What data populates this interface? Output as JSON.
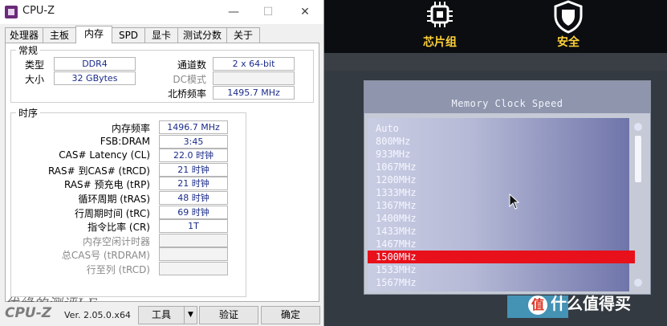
{
  "cpuz": {
    "app_title": "CPU-Z",
    "window_buttons": {
      "minimize": "—",
      "maximize": "☐",
      "close": "✕"
    },
    "tabs": [
      {
        "label": "处理器"
      },
      {
        "label": "主板"
      },
      {
        "label": "内存"
      },
      {
        "label": "SPD"
      },
      {
        "label": "显卡"
      },
      {
        "label": "测试分数"
      },
      {
        "label": "关于"
      }
    ],
    "general": {
      "legend": "常规",
      "type_label": "类型",
      "type_value": "DDR4",
      "size_label": "大小",
      "size_value": "32 GBytes",
      "channels_label": "通道数",
      "channels_value": "2 x 64-bit",
      "dc_mode_label": "DC模式",
      "dc_mode_value": "",
      "nb_freq_label": "北桥频率",
      "nb_freq_value": "1495.7 MHz"
    },
    "timings": {
      "legend": "时序",
      "rows": [
        {
          "label": "内存频率",
          "value": "1496.7 MHz"
        },
        {
          "label": "FSB:DRAM",
          "value": "3:45"
        },
        {
          "label": "CAS# Latency (CL)",
          "value": "22.0 时钟"
        },
        {
          "label": "RAS# 到CAS# (tRCD)",
          "value": "21 时钟"
        },
        {
          "label": "RAS# 预充电 (tRP)",
          "value": "21 时钟"
        },
        {
          "label": "循环周期 (tRAS)",
          "value": "48 时钟"
        },
        {
          "label": "行周期时间 (tRC)",
          "value": "69 时钟"
        },
        {
          "label": "指令比率 (CR)",
          "value": "1T"
        },
        {
          "label": "内存空闲计时器",
          "value": ""
        },
        {
          "label": "总CAS号 (tRDRAM)",
          "value": ""
        },
        {
          "label": "行至列 (tRCD)",
          "value": ""
        }
      ]
    },
    "footer": {
      "brand": "CPU-Z",
      "version": "Ver. 2.05.0.x64",
      "tools_button": "工具",
      "tools_dropdown": "▼",
      "validate_button": "验证",
      "ok_button": "确定",
      "handwriting": "优缘的测评J.F"
    }
  },
  "bios": {
    "tabs": [
      {
        "label": ""
      },
      {
        "label": "芯片组"
      },
      {
        "label": "安全"
      }
    ],
    "memory_clock": {
      "title": "Memory Clock Speed",
      "options": [
        "Auto",
        "800MHz",
        "933MHz",
        "1067MHz",
        "1200MHz",
        "1333MHz",
        "1367MHz",
        "1400MHz",
        "1433MHz",
        "1467MHz",
        "1500MHz",
        "1533MHz",
        "1567MHz"
      ],
      "selected": "1500MHz"
    },
    "watermark": "什么值得买",
    "watermark_icon": "值",
    "colors": {
      "selected": "#e8101a",
      "tab_text": "#ffd23a"
    }
  }
}
